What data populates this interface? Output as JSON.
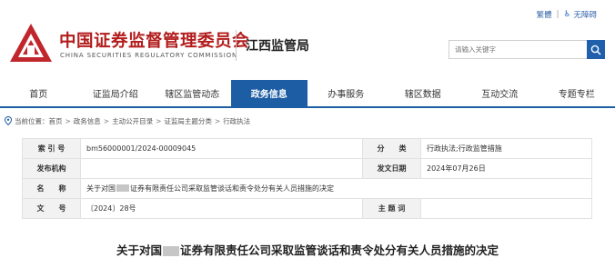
{
  "util_links": {
    "traditional": "繁體",
    "accessibility": "无障碍"
  },
  "org": {
    "cn_name": "中国证券监督管理委员会",
    "en_name": "CHINA SECURITIES REGULATORY COMMISSION",
    "bureau": "江西监管局",
    "logo_icon": "csrc-logo",
    "brand_color": "#b31c1c"
  },
  "search": {
    "placeholder": "请输入关键字",
    "button_icon": "search-icon",
    "button_color": "#1f5fab"
  },
  "nav": {
    "active_color": "#1d5da3",
    "items": [
      {
        "label": "首页"
      },
      {
        "label": "证监局介绍"
      },
      {
        "label": "辖区监管动态"
      },
      {
        "label": "政务信息",
        "active": true
      },
      {
        "label": "办事服务"
      },
      {
        "label": "辖区数据"
      },
      {
        "label": "互动交流"
      },
      {
        "label": "专题专栏"
      }
    ]
  },
  "breadcrumb": {
    "prefix": "当前位置：",
    "items": [
      "首页",
      "政务信息",
      "主动公开目录",
      "证监局主题分类",
      "行政执法"
    ]
  },
  "info_table": {
    "index_label": "索 引 号",
    "index_value": "bm56000001/2024-00009045",
    "category_label": "分　　类",
    "category_value": "行政执法;行政监管措施",
    "publisher_label": "发布机构",
    "publisher_value": "",
    "date_label": "发文日期",
    "date_value": "2024年07月26日",
    "name_label": "名　　称",
    "name_value_a": "关于对国",
    "name_value_b": "证券有限责任公司采取监管谈话和责令处分有关人员措施的决定",
    "docno_label": "文　　号",
    "docno_value": "〔2024〕28号",
    "topic_label": "主 题 词",
    "topic_value": ""
  },
  "article": {
    "title_a": "关于对国",
    "title_b": "证券有限责任公司采取监管谈话和责令处分有关人员措施的决定"
  }
}
